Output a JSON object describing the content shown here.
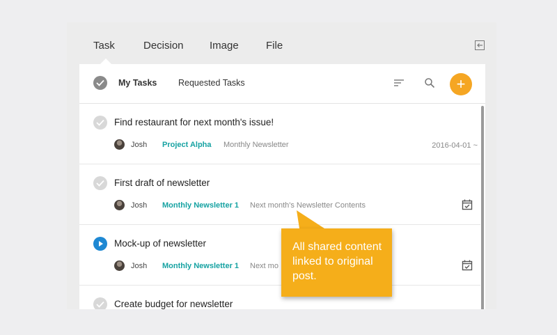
{
  "tabs": [
    "Task",
    "Decision",
    "Image",
    "File"
  ],
  "toolbar": {
    "my_tasks": "My Tasks",
    "requested_tasks": "Requested Tasks",
    "add_label": "+"
  },
  "tasks": [
    {
      "title": "Find restaurant for next month's issue!",
      "author": "Josh",
      "project": "Project Alpha",
      "board": "Monthly Newsletter",
      "date": "2016-04-01 ~",
      "status": "done"
    },
    {
      "title": "First draft of newsletter",
      "author": "Josh",
      "project": "Monthly Newsletter 1",
      "board": "Next month's Newsletter Contents",
      "date": "",
      "status": "done"
    },
    {
      "title": "Mock-up of newsletter",
      "author": "Josh",
      "project": "Monthly Newsletter 1",
      "board": "Next mo",
      "date": "",
      "status": "in-progress"
    },
    {
      "title": "Create budget for newsletter",
      "author": "",
      "project": "",
      "board": "",
      "date": "",
      "status": "done"
    }
  ],
  "callout": {
    "text": "All shared content linked to original post."
  },
  "colors": {
    "accent": "#f5a623",
    "link": "#16a2a2",
    "progress": "#1e88d3",
    "callout": "#f5ae1a"
  }
}
